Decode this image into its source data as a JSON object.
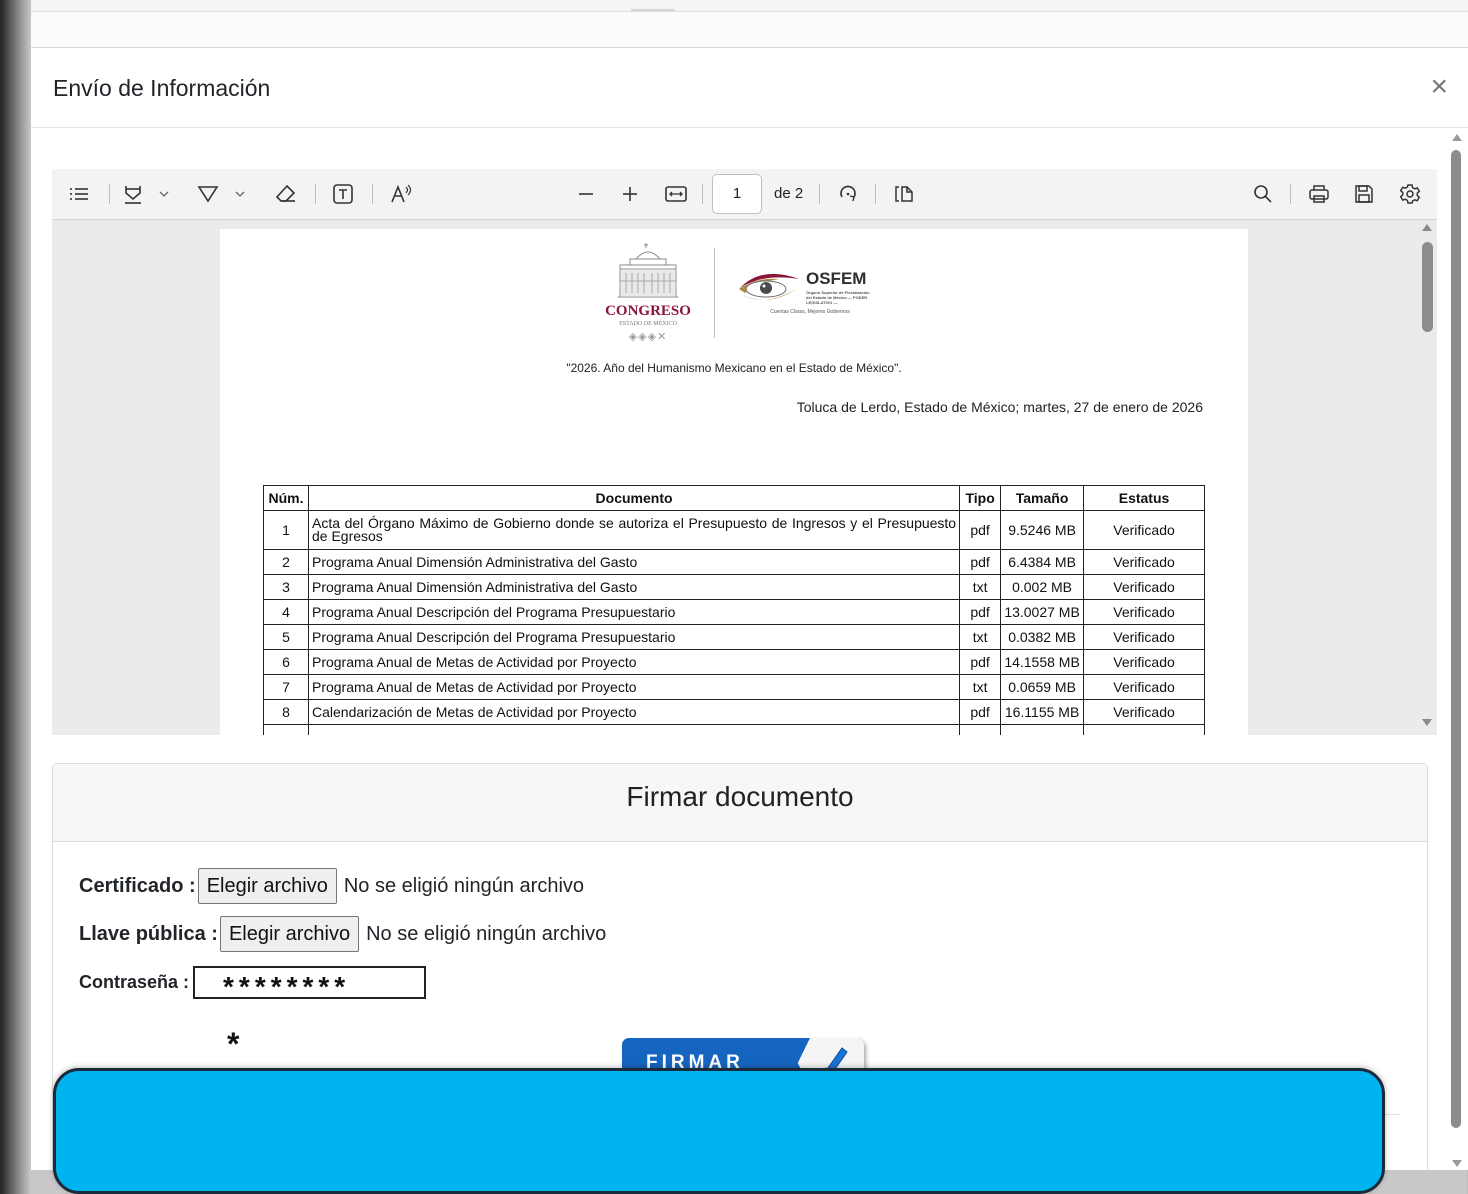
{
  "modal": {
    "title": "Envío de Información",
    "close_glyph": "×"
  },
  "viewer": {
    "toolbar": {
      "page_current": "1",
      "page_total": "de 2",
      "icons": [
        "toc-icon",
        "highlight-icon",
        "chevron-down-icon",
        "draw-icon",
        "chevron-down-icon",
        "eraser-icon",
        "text-box-icon",
        "read-aloud-icon",
        "zoom-out-icon",
        "zoom-in-icon",
        "fit-width-icon",
        "rotate-icon",
        "page-view-icon",
        "search-icon",
        "print-icon",
        "save-icon",
        "settings-icon"
      ]
    },
    "page": {
      "congreso_name": "CONGRESO",
      "congreso_sub": "ESTADO DE MÉXICO",
      "congreso_marks": "◈◈◈✕",
      "osfem_name": "OSFEM",
      "osfem_desc": "Órgano Superior de Fiscalización del Estado de México — PODER LEGISLATIVO —",
      "osfem_tagline": "Cuentas Claras, Mejores Gobiernos",
      "motto": "\"2026. Año del Humanismo Mexicano en el Estado de México\".",
      "place_date": "Toluca de Lerdo, Estado de México; martes, 27 de enero de 2026",
      "table": {
        "headers": [
          "Núm.",
          "Documento",
          "Tipo",
          "Tamaño",
          "Estatus"
        ],
        "rows": [
          {
            "num": "1",
            "doc": "Acta del Órgano Máximo de Gobierno donde se autoriza el Presupuesto de Ingresos y el Presupuesto de Egresos",
            "tipo": "pdf",
            "size": "9.5246 MB",
            "status": "Verificado"
          },
          {
            "num": "2",
            "doc": "Programa Anual Dimensión Administrativa del Gasto",
            "tipo": "pdf",
            "size": "6.4384 MB",
            "status": "Verificado"
          },
          {
            "num": "3",
            "doc": "Programa Anual Dimensión Administrativa del Gasto",
            "tipo": "txt",
            "size": "0.002 MB",
            "status": "Verificado"
          },
          {
            "num": "4",
            "doc": "Programa Anual Descripción del Programa Presupuestario",
            "tipo": "pdf",
            "size": "13.0027 MB",
            "status": "Verificado"
          },
          {
            "num": "5",
            "doc": "Programa Anual Descripción del Programa Presupuestario",
            "tipo": "txt",
            "size": "0.0382 MB",
            "status": "Verificado"
          },
          {
            "num": "6",
            "doc": "Programa Anual de Metas de Actividad por Proyecto",
            "tipo": "pdf",
            "size": "14.1558 MB",
            "status": "Verificado"
          },
          {
            "num": "7",
            "doc": "Programa Anual de Metas de Actividad por Proyecto",
            "tipo": "txt",
            "size": "0.0659 MB",
            "status": "Verificado"
          },
          {
            "num": "8",
            "doc": "Calendarización de Metas de Actividad por Proyecto",
            "tipo": "pdf",
            "size": "16.1155 MB",
            "status": "Verificado"
          },
          {
            "num": "",
            "doc": "",
            "tipo": "",
            "size": "",
            "status": ""
          }
        ]
      }
    }
  },
  "sign": {
    "title": "Firmar documento",
    "cert_label": "Certificado :",
    "key_label": "Llave pública :",
    "password_label": "Contraseña :",
    "file_button": "Elegir archivo",
    "no_file": "No se eligió ningún archivo",
    "password_value": "********",
    "required_mark": "*",
    "submit_label": "FIRMAR"
  },
  "colors": {
    "accent_blue": "#1565c0",
    "bottom_button": "#00b4ef",
    "congreso_red": "#8b1538"
  }
}
